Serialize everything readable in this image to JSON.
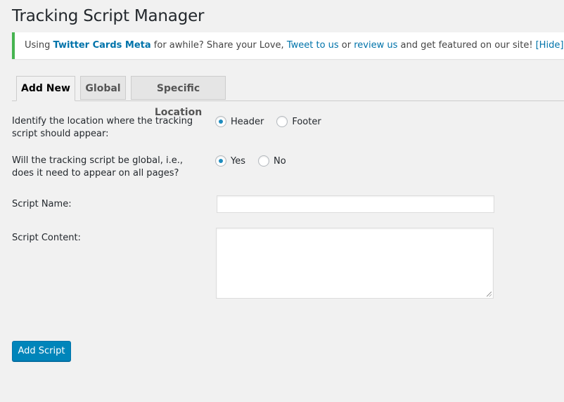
{
  "page": {
    "title": "Tracking Script Manager"
  },
  "notice": {
    "text_before": "Using ",
    "plugin_link": "Twitter Cards Meta",
    "text_mid1": " for awhile? Share your Love, ",
    "tweet_link": "Tweet to us",
    "text_or": " or ",
    "review_link": "review us",
    "text_after": " and get featured on our site!",
    "hide_link": "[Hide]",
    "accent_color": "#46b450",
    "link_color": "#0073aa"
  },
  "tabs": [
    {
      "label": "Add New",
      "active": true
    },
    {
      "label": "Global",
      "active": false
    },
    {
      "label": "Specific Location",
      "active": false
    }
  ],
  "form": {
    "location": {
      "label_line1": "Identify the location where the tracking",
      "label_line2": "script should appear:",
      "options": [
        {
          "label": "Header",
          "checked": true
        },
        {
          "label": "Footer",
          "checked": false
        }
      ]
    },
    "global": {
      "label_line1": "Will the tracking script be global, i.e.,",
      "label_line2": "does it need to appear on all pages?",
      "options": [
        {
          "label": "Yes",
          "checked": true
        },
        {
          "label": "No",
          "checked": false
        }
      ]
    },
    "script_name": {
      "label": "Script Name:",
      "value": ""
    },
    "script_content": {
      "label": "Script Content:",
      "value": ""
    },
    "submit_label": "Add Script",
    "button_color": "#0085ba"
  }
}
